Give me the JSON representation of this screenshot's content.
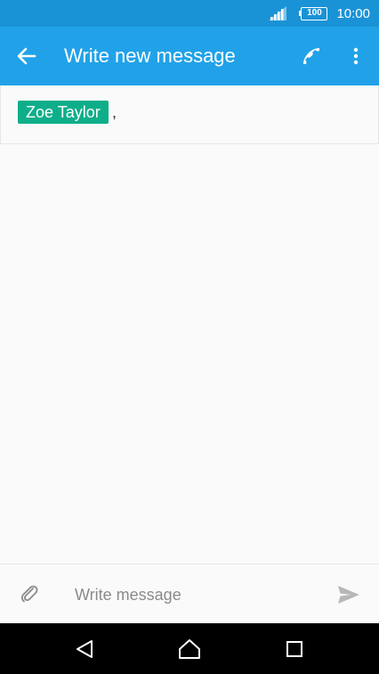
{
  "status_bar": {
    "battery_level": "100",
    "time": "10:00",
    "icons": [
      "signal-icon",
      "battery-icon"
    ]
  },
  "app_bar": {
    "title": "Write new message",
    "icons": [
      "back-arrow-icon",
      "phone-icon",
      "more-vert-icon"
    ]
  },
  "recipients": [
    {
      "name": "Zoe Taylor"
    }
  ],
  "recipient_separator": ",",
  "compose": {
    "placeholder": "Write message",
    "value": "",
    "icons": [
      "paperclip-icon",
      "send-icon"
    ]
  },
  "nav_bar": {
    "icons": [
      "nav-back-icon",
      "nav-home-icon",
      "nav-recents-icon"
    ]
  },
  "colors": {
    "status_bar": "#1a93d6",
    "app_bar": "#21a2e8",
    "chip": "#0fae8a",
    "nav_bar": "#000000"
  }
}
